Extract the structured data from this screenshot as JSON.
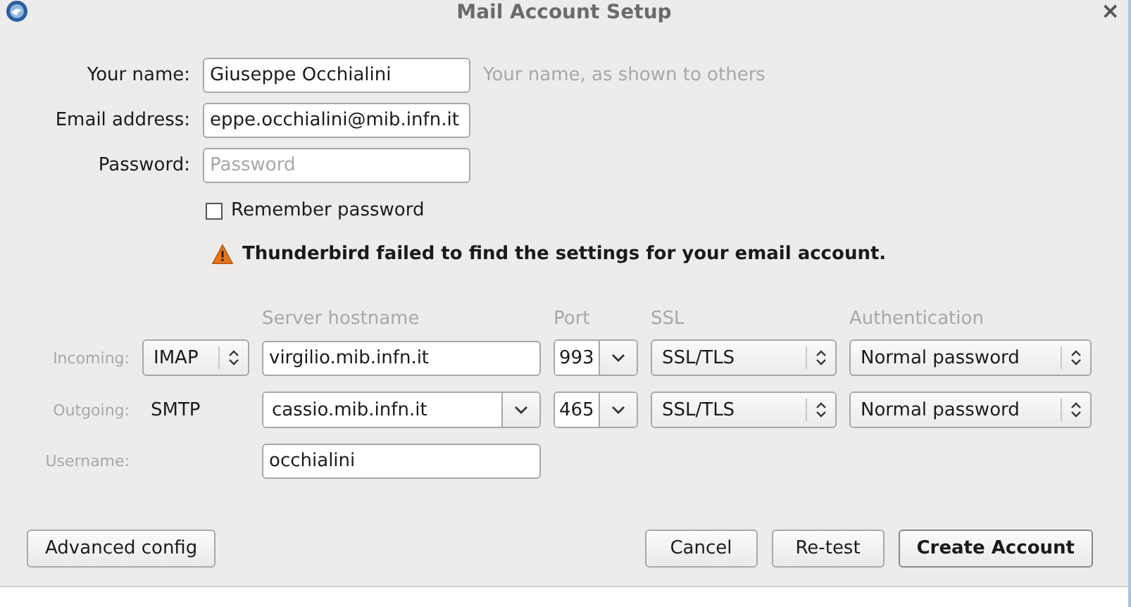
{
  "window": {
    "title": "Mail Account Setup",
    "close": "×"
  },
  "identity": [
    {
      "label": "Your name:",
      "value": "Giuseppe Occhialini",
      "hint": "Your name, as shown to others"
    },
    {
      "label": "Email address:",
      "value": "eppe.occhialini@mib.infn.it"
    },
    {
      "label": "Password:",
      "placeholder": "Password"
    }
  ],
  "remember_password": {
    "label": "Remember password",
    "checked": false
  },
  "warning": "Thunderbird failed to find the settings for your email account.",
  "server": {
    "columns": [
      "Server hostname",
      "Port",
      "SSL",
      "Authentication"
    ],
    "rows": [
      {
        "label": "Incoming:",
        "protocol": {
          "kind": "select",
          "value": "IMAP"
        },
        "hostname": {
          "kind": "text",
          "value": "virgilio.mib.infn.it"
        },
        "port": "993",
        "ssl": "SSL/TLS",
        "auth": "Normal password"
      },
      {
        "label": "Outgoing:",
        "protocol": {
          "kind": "static",
          "value": "SMTP"
        },
        "hostname": {
          "kind": "combo",
          "value": "cassio.mib.infn.it"
        },
        "port": "465",
        "ssl": "SSL/TLS",
        "auth": "Normal password"
      }
    ],
    "username": {
      "label": "Username:",
      "value": "occhialini"
    }
  },
  "buttons": [
    {
      "label": "Advanced config",
      "default": false
    },
    {
      "label": "Cancel",
      "default": false
    },
    {
      "label": "Re-test",
      "default": false
    },
    {
      "label": "Create Account",
      "default": true
    }
  ]
}
